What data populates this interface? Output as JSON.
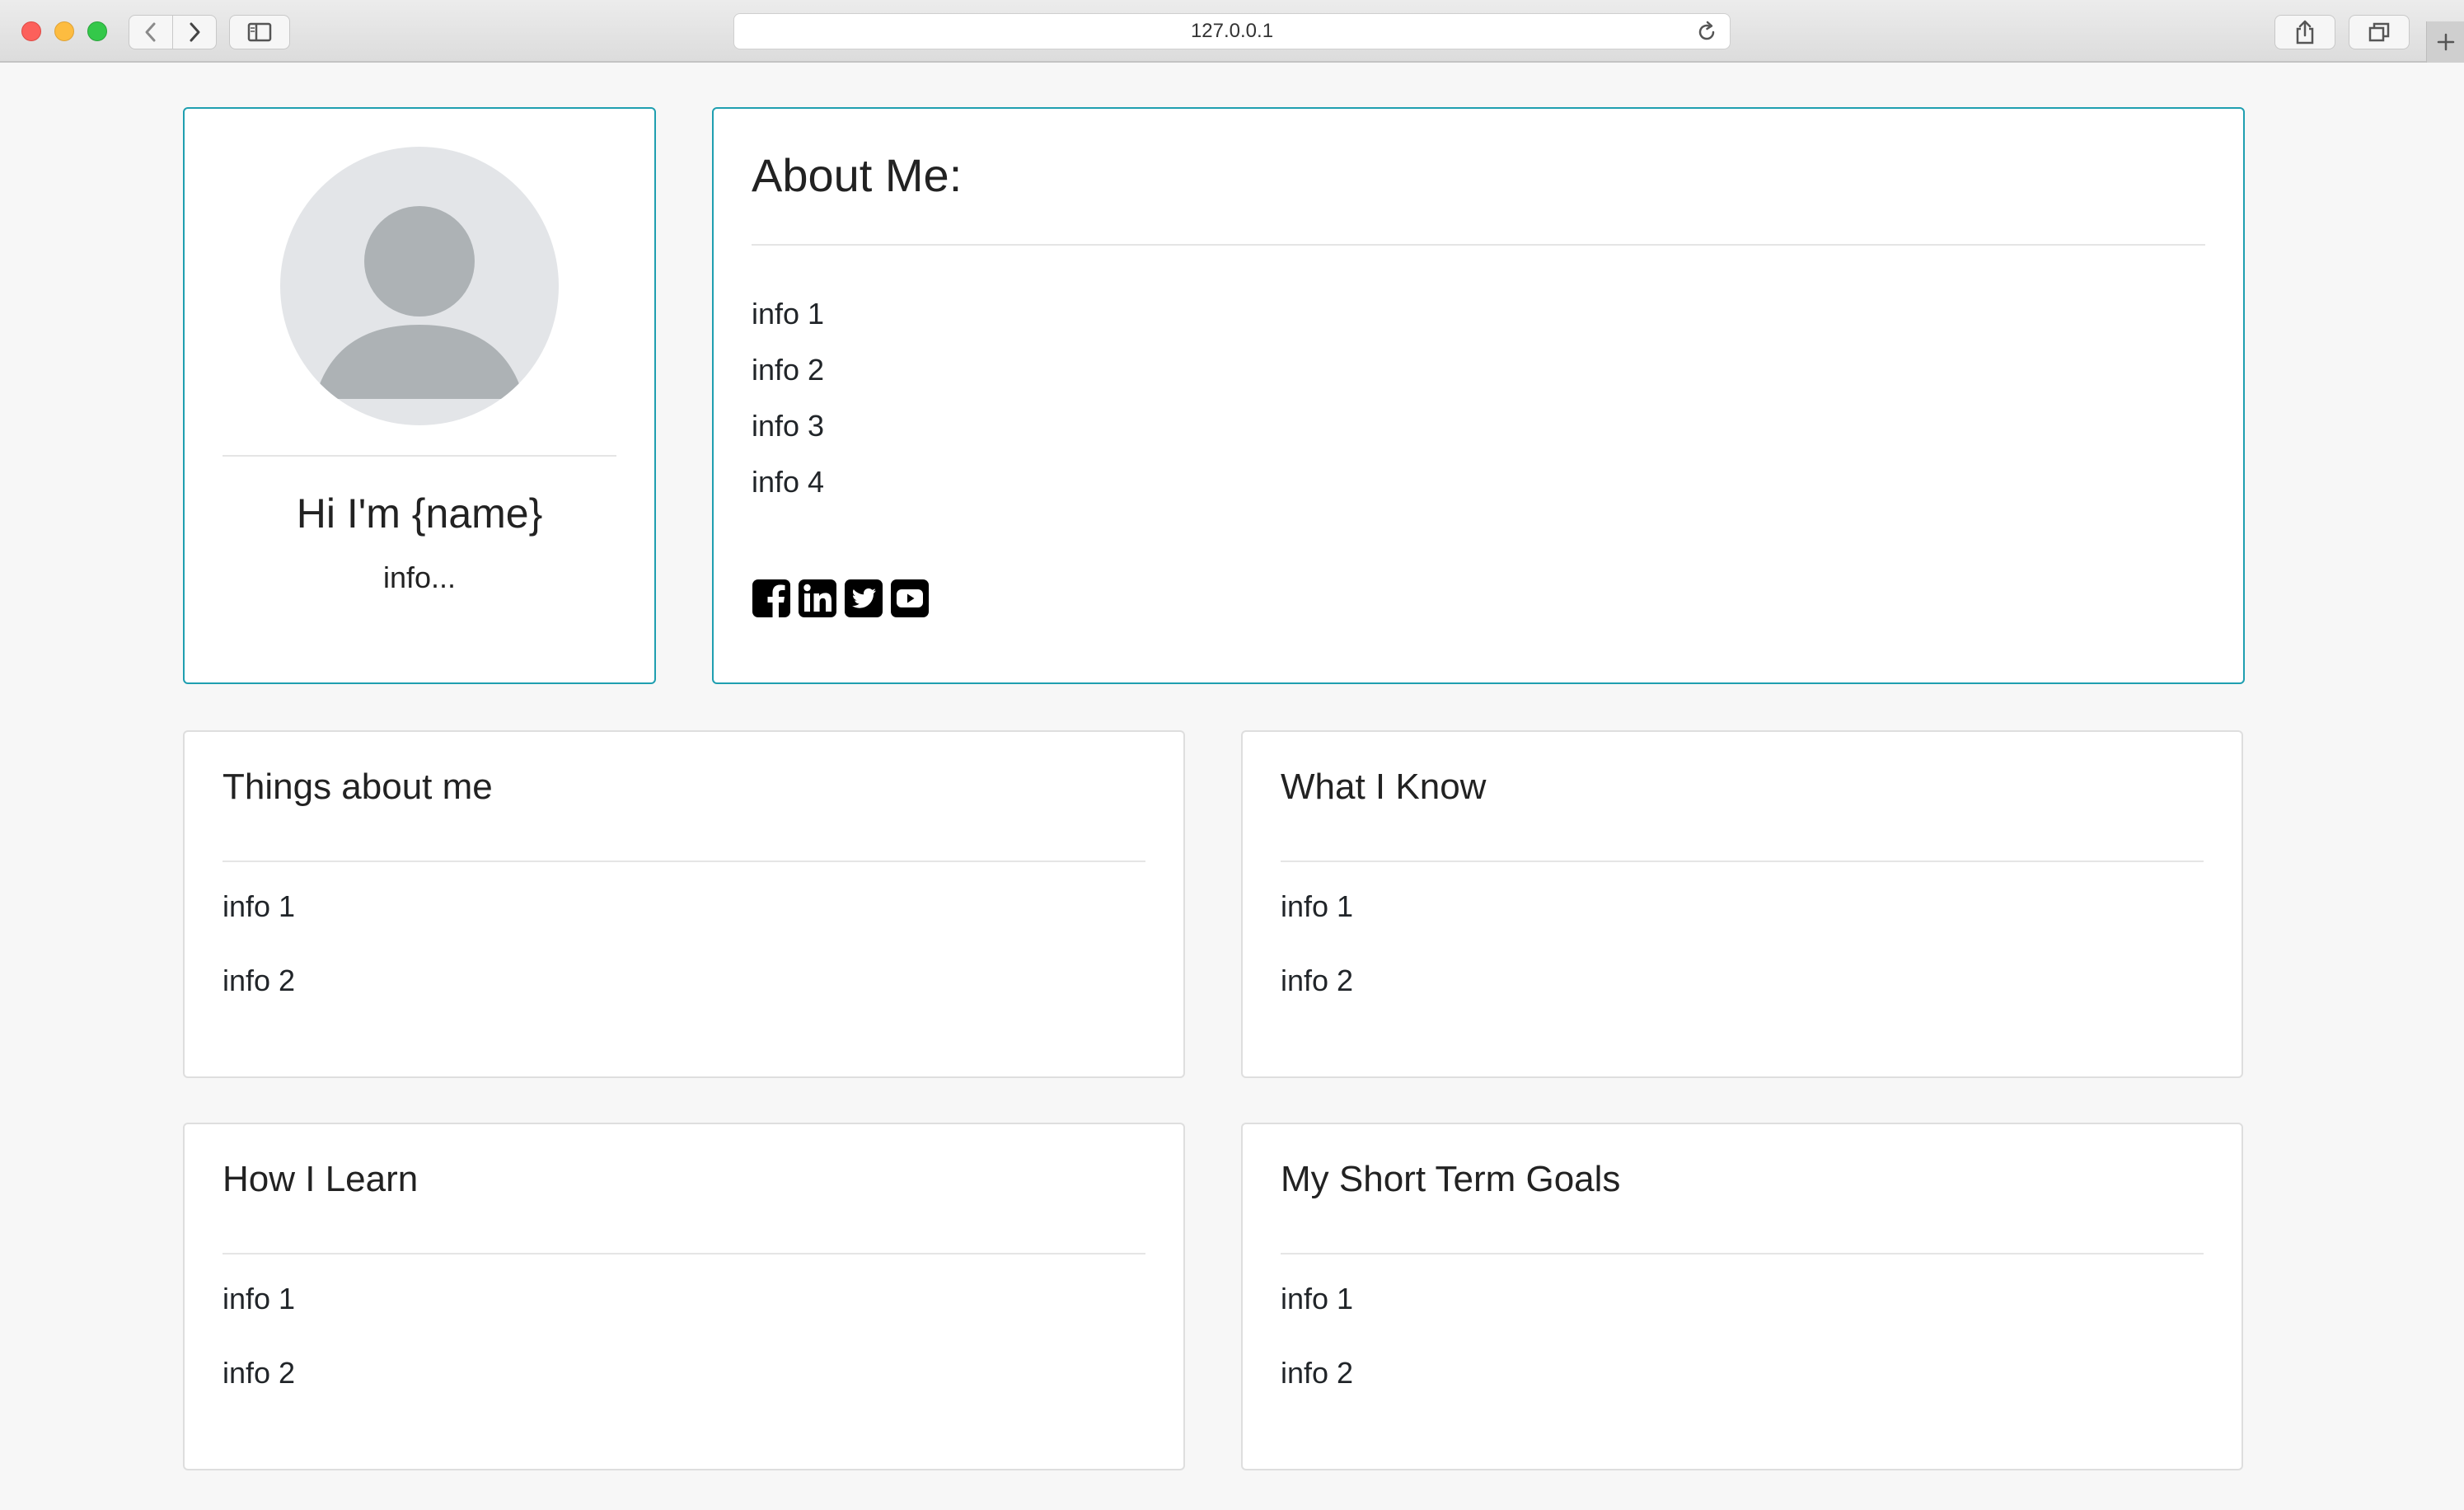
{
  "browser": {
    "url": "127.0.0.1"
  },
  "profile": {
    "name": "Hi I'm {name}",
    "info": "info..."
  },
  "about": {
    "title": "About Me:",
    "items": [
      "info 1",
      "info 2",
      "info 3",
      "info 4"
    ],
    "social_icons": [
      "facebook-icon",
      "linkedin-icon",
      "twitter-icon",
      "youtube-icon"
    ]
  },
  "cards": {
    "things": {
      "title": "Things about me",
      "items": [
        "info 1",
        "info 2"
      ]
    },
    "know": {
      "title": "What I Know",
      "items": [
        "info 1",
        "info 2"
      ]
    },
    "learn": {
      "title": "How I Learn",
      "items": [
        "info 1",
        "info 2"
      ]
    },
    "goals": {
      "title": "My Short Term Goals",
      "items": [
        "info 1",
        "info 2"
      ]
    }
  },
  "colors": {
    "accent_border": "#1f9fb0",
    "page_background": "#f7f7f7",
    "card_border": "#dedede"
  }
}
